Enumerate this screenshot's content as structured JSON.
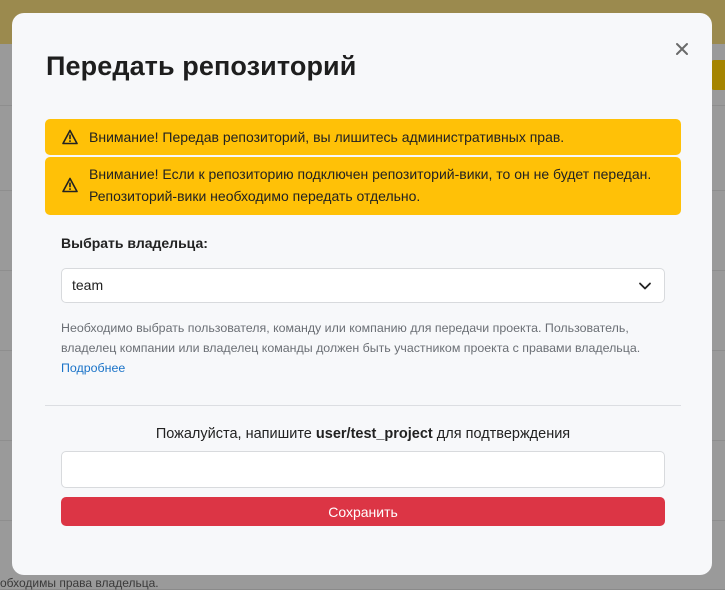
{
  "background": {
    "footer_text": "обходимы права владельца."
  },
  "modal": {
    "title": "Передать репозиторий",
    "close_icon": "close-icon",
    "alerts": [
      {
        "icon": "warning-icon",
        "text": "Внимание! Передав репозиторий, вы лишитесь административных прав."
      },
      {
        "icon": "warning-icon",
        "text": "Внимание! Если к репозиторию подключен репозиторий-вики, то он не будет передан. Репозиторий-вики необходимо передать отдельно."
      }
    ],
    "owner_label": "Выбрать владельца:",
    "owner_select": {
      "value": "team"
    },
    "help_text": "Необходимо выбрать пользователя, команду или компанию для передачи проекта. Пользователь, владелец компании или владелец команды должен быть участником проекта с правами владельца.",
    "help_link": "Подробнее",
    "confirm": {
      "prefix": "Пожалуйста, напишите ",
      "project": "user/test_project",
      "suffix": " для подтверждения",
      "input_value": ""
    },
    "save_label": "Сохранить"
  },
  "colors": {
    "alert": "#ffc107",
    "save": "#dc3545",
    "link": "#1a73c8"
  }
}
